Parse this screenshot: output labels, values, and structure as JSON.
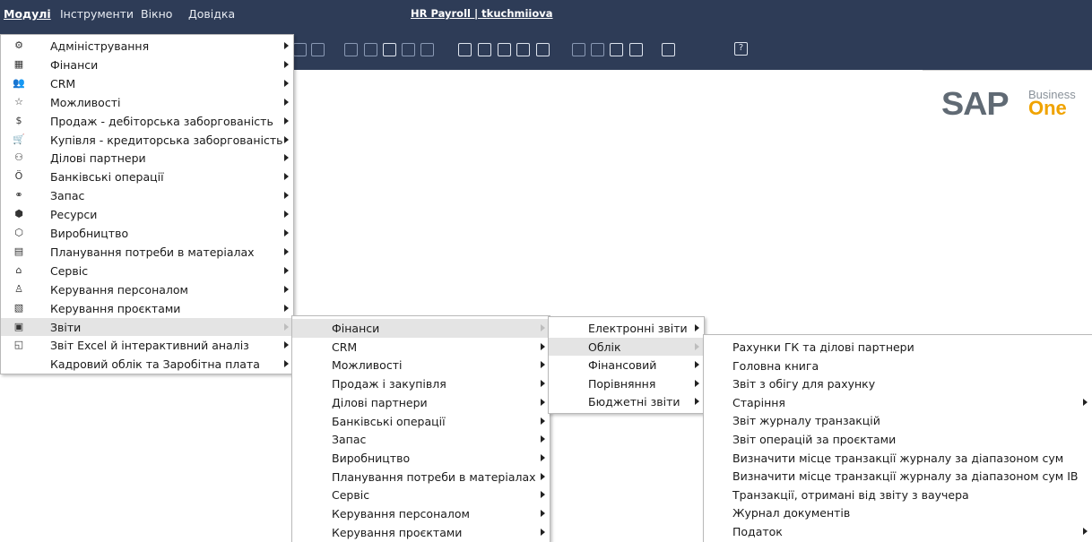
{
  "menubar": {
    "items": [
      {
        "label": "Модулі",
        "active": true
      },
      {
        "label": "Інструменти",
        "active": false
      },
      {
        "label": "Вікно",
        "active": false
      },
      {
        "label": "Довідка",
        "active": false
      }
    ],
    "title": "HR Payroll | tkuchmiiova"
  },
  "toolbar": {
    "help_label": "?"
  },
  "logo": {
    "sap": "SAP",
    "business": "Business",
    "one": "One"
  },
  "modules_menu": [
    {
      "icon": "admin-icon",
      "glyph": "⚙",
      "label": "Адміністрування",
      "sub": true
    },
    {
      "icon": "finance-icon",
      "glyph": "▦",
      "label": "Фінанси",
      "sub": true
    },
    {
      "icon": "crm-icon",
      "glyph": "👥",
      "label": "CRM",
      "sub": true
    },
    {
      "icon": "opportunities-icon",
      "glyph": "☆",
      "label": "Можливості",
      "sub": true
    },
    {
      "icon": "sales-icon",
      "glyph": "$",
      "label": "Продаж - дебіторська заборгованість",
      "sub": true
    },
    {
      "icon": "cart-icon",
      "glyph": "🛒",
      "label": "Купівля - кредиторська заборгованість",
      "sub": true
    },
    {
      "icon": "partners-icon",
      "glyph": "⚇",
      "label": "Ділові партнери",
      "sub": true
    },
    {
      "icon": "banking-icon",
      "glyph": "Ӧ",
      "label": "Банківські операції",
      "sub": true
    },
    {
      "icon": "inventory-icon",
      "glyph": "⚭",
      "label": "Запас",
      "sub": true
    },
    {
      "icon": "resources-icon",
      "glyph": "⬢",
      "label": "Ресурси",
      "sub": true
    },
    {
      "icon": "production-icon",
      "glyph": "⬡",
      "label": "Виробництво",
      "sub": true
    },
    {
      "icon": "mrp-icon",
      "glyph": "▤",
      "label": "Планування потреби в матеріалах",
      "sub": true
    },
    {
      "icon": "service-icon",
      "glyph": "⌂",
      "label": "Сервіс",
      "sub": true
    },
    {
      "icon": "hr-icon",
      "glyph": "♙",
      "label": "Керування персоналом",
      "sub": true
    },
    {
      "icon": "projects-icon",
      "glyph": "▧",
      "label": "Керування проєктами",
      "sub": true
    },
    {
      "icon": "reports-icon",
      "glyph": "▣",
      "label": "Звіти",
      "sub": true,
      "highlighted": true
    },
    {
      "icon": "excel-report-icon",
      "glyph": "◱",
      "label": "Звіт Excel й інтерактивний аналіз",
      "sub": true
    },
    {
      "icon": "",
      "glyph": "",
      "label": "Кадровий облік та Заробітна плата",
      "sub": true
    }
  ],
  "reports_menu": [
    {
      "label": "Фінанси",
      "sub": true,
      "highlighted": true
    },
    {
      "label": "CRM",
      "sub": true
    },
    {
      "label": "Можливості",
      "sub": true
    },
    {
      "label": "Продаж і закупівля",
      "sub": true
    },
    {
      "label": "Ділові партнери",
      "sub": true
    },
    {
      "label": "Банківські операції",
      "sub": true
    },
    {
      "label": "Запас",
      "sub": true
    },
    {
      "label": "Виробництво",
      "sub": true
    },
    {
      "label": "Планування потреби в матеріалах",
      "sub": true
    },
    {
      "label": "Сервіс",
      "sub": true
    },
    {
      "label": "Керування персоналом",
      "sub": true
    },
    {
      "label": "Керування проєктами",
      "sub": true
    }
  ],
  "finance_menu": [
    {
      "label": "Електронні звіти",
      "sub": true
    },
    {
      "label": "Облік",
      "sub": true,
      "highlighted": true
    },
    {
      "label": "Фінансовий",
      "sub": true
    },
    {
      "label": "Порівняння",
      "sub": true
    },
    {
      "label": "Бюджетні звіти",
      "sub": true
    }
  ],
  "accounting_menu": [
    {
      "label": "Рахунки ГК та ділові партнери",
      "sub": false
    },
    {
      "label": "Головна книга",
      "sub": false
    },
    {
      "label": "Звіт з обігу для рахунку",
      "sub": false
    },
    {
      "label": "Старіння",
      "sub": true
    },
    {
      "label": "Звіт журналу транзакцій",
      "sub": false
    },
    {
      "label": "Звіт операцій за проєктами",
      "sub": false
    },
    {
      "label": "Визначити місце транзакції журналу за діапазоном сум",
      "sub": false
    },
    {
      "label": "Визначити місце транзакції журналу за діапазоном сум IB",
      "sub": false
    },
    {
      "label": "Транзакції, отримані від звіту з ваучера",
      "sub": false
    },
    {
      "label": "Журнал документів",
      "sub": false
    },
    {
      "label": "Податок",
      "sub": true
    }
  ]
}
